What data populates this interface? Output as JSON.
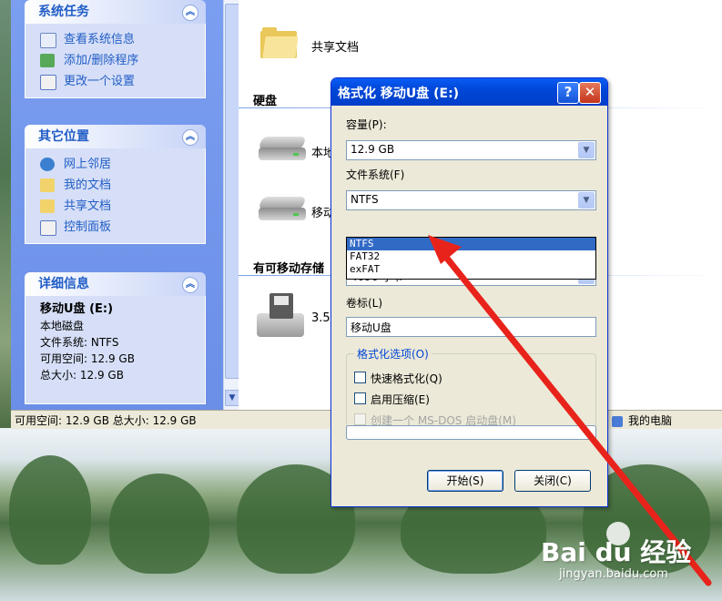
{
  "task_pane": {
    "system_tasks": {
      "title": "系统任务",
      "items": [
        "查看系统信息",
        "添加/删除程序",
        "更改一个设置"
      ]
    },
    "other_places": {
      "title": "其它位置",
      "items": [
        "网上邻居",
        "我的文档",
        "共享文档",
        "控制面板"
      ]
    },
    "details": {
      "title": "详细信息",
      "drive_name": "移动U盘 (E:)",
      "drive_type": "本地磁盘",
      "file_system": "文件系统: NTFS",
      "free_space": "可用空间: 12.9 GB",
      "total_size": "总大小: 12.9 GB"
    }
  },
  "content": {
    "shared_docs": "共享文档",
    "hard_disks_header": "硬盘",
    "local_disk_label": "本地",
    "removable_label": "移动",
    "removable_storage_header": "有可移动存储",
    "floppy_label": "3.5"
  },
  "status_bar": {
    "text": "可用空间: 12.9 GB 总大小: 12.9 GB",
    "computer": "我的电脑"
  },
  "dialog": {
    "title": "格式化 移动U盘 (E:)",
    "help_button": "?",
    "close_button": "✕",
    "capacity_label": "容量(P):",
    "capacity_value": "12.9 GB",
    "filesystem_label": "文件系统(F)",
    "filesystem_value": "NTFS",
    "filesystem_options": [
      "NTFS",
      "FAT32",
      "exFAT"
    ],
    "filesystem_selected_index": 0,
    "allocation_partial": "4096 字节",
    "volume_label_label": "卷标(L)",
    "volume_label_value": "移动U盘",
    "format_options_title": "格式化选项(O)",
    "quick_format": "快速格式化(Q)",
    "enable_compression": "启用压缩(E)",
    "create_msdos": "创建一个 MS-DOS 启动盘(M)",
    "start_button": "开始(S)",
    "close_text_button": "关闭(C)",
    "progress": 0
  },
  "watermark": {
    "brand": "Bai du 经验",
    "url": "jingyan.baidu.com"
  },
  "colors": {
    "taskpane_blue": "#6b8fe6",
    "title_blue": "#0047d8",
    "annotation_arrow": "#e8231b",
    "selection": "#316ac5"
  }
}
